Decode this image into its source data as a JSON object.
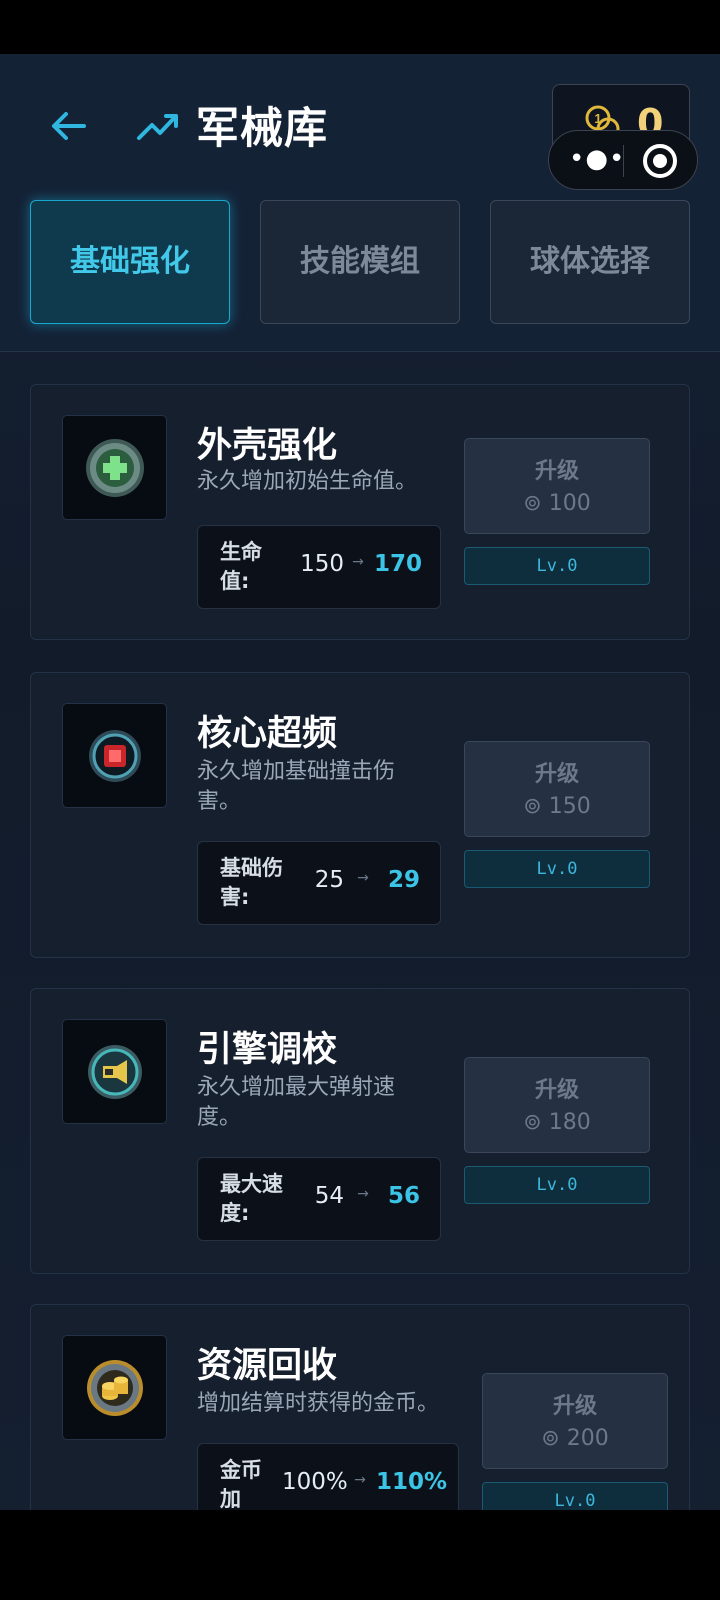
{
  "header": {
    "title": "军械库",
    "coins": "0"
  },
  "tabs": [
    {
      "label": "基础强化",
      "active": true
    },
    {
      "label": "技能模组",
      "active": false
    },
    {
      "label": "球体选择",
      "active": false
    }
  ],
  "cards": [
    {
      "icon": "shield-health-icon",
      "title": "外壳强化",
      "desc": "永久增加初始生命值。",
      "stat_label": "生命值:",
      "from": "150",
      "to": "170",
      "upgrade_label": "升级",
      "cost": "100",
      "level": "Lv.0"
    },
    {
      "icon": "core-chip-icon",
      "title": "核心超频",
      "desc": "永久增加基础撞击伤害。",
      "stat_label": "基础伤害:",
      "from": "25",
      "to": "29",
      "upgrade_label": "升级",
      "cost": "150",
      "level": "Lv.0"
    },
    {
      "icon": "engine-thruster-icon",
      "title": "引擎调校",
      "desc": "永久增加最大弹射速度。",
      "stat_label": "最大速度:",
      "from": "54",
      "to": "56",
      "upgrade_label": "升级",
      "cost": "180",
      "level": "Lv.0"
    },
    {
      "icon": "coin-stack-icon",
      "title": "资源回收",
      "desc": "增加结算时获得的金币。",
      "stat_label": "金币加成:",
      "from": "100%",
      "to": "110%",
      "upgrade_label": "升级",
      "cost": "200",
      "level": "Lv.0"
    }
  ],
  "colors": {
    "accent": "#3cc4e6",
    "gold": "#f1d27a",
    "background": "#141f30"
  }
}
